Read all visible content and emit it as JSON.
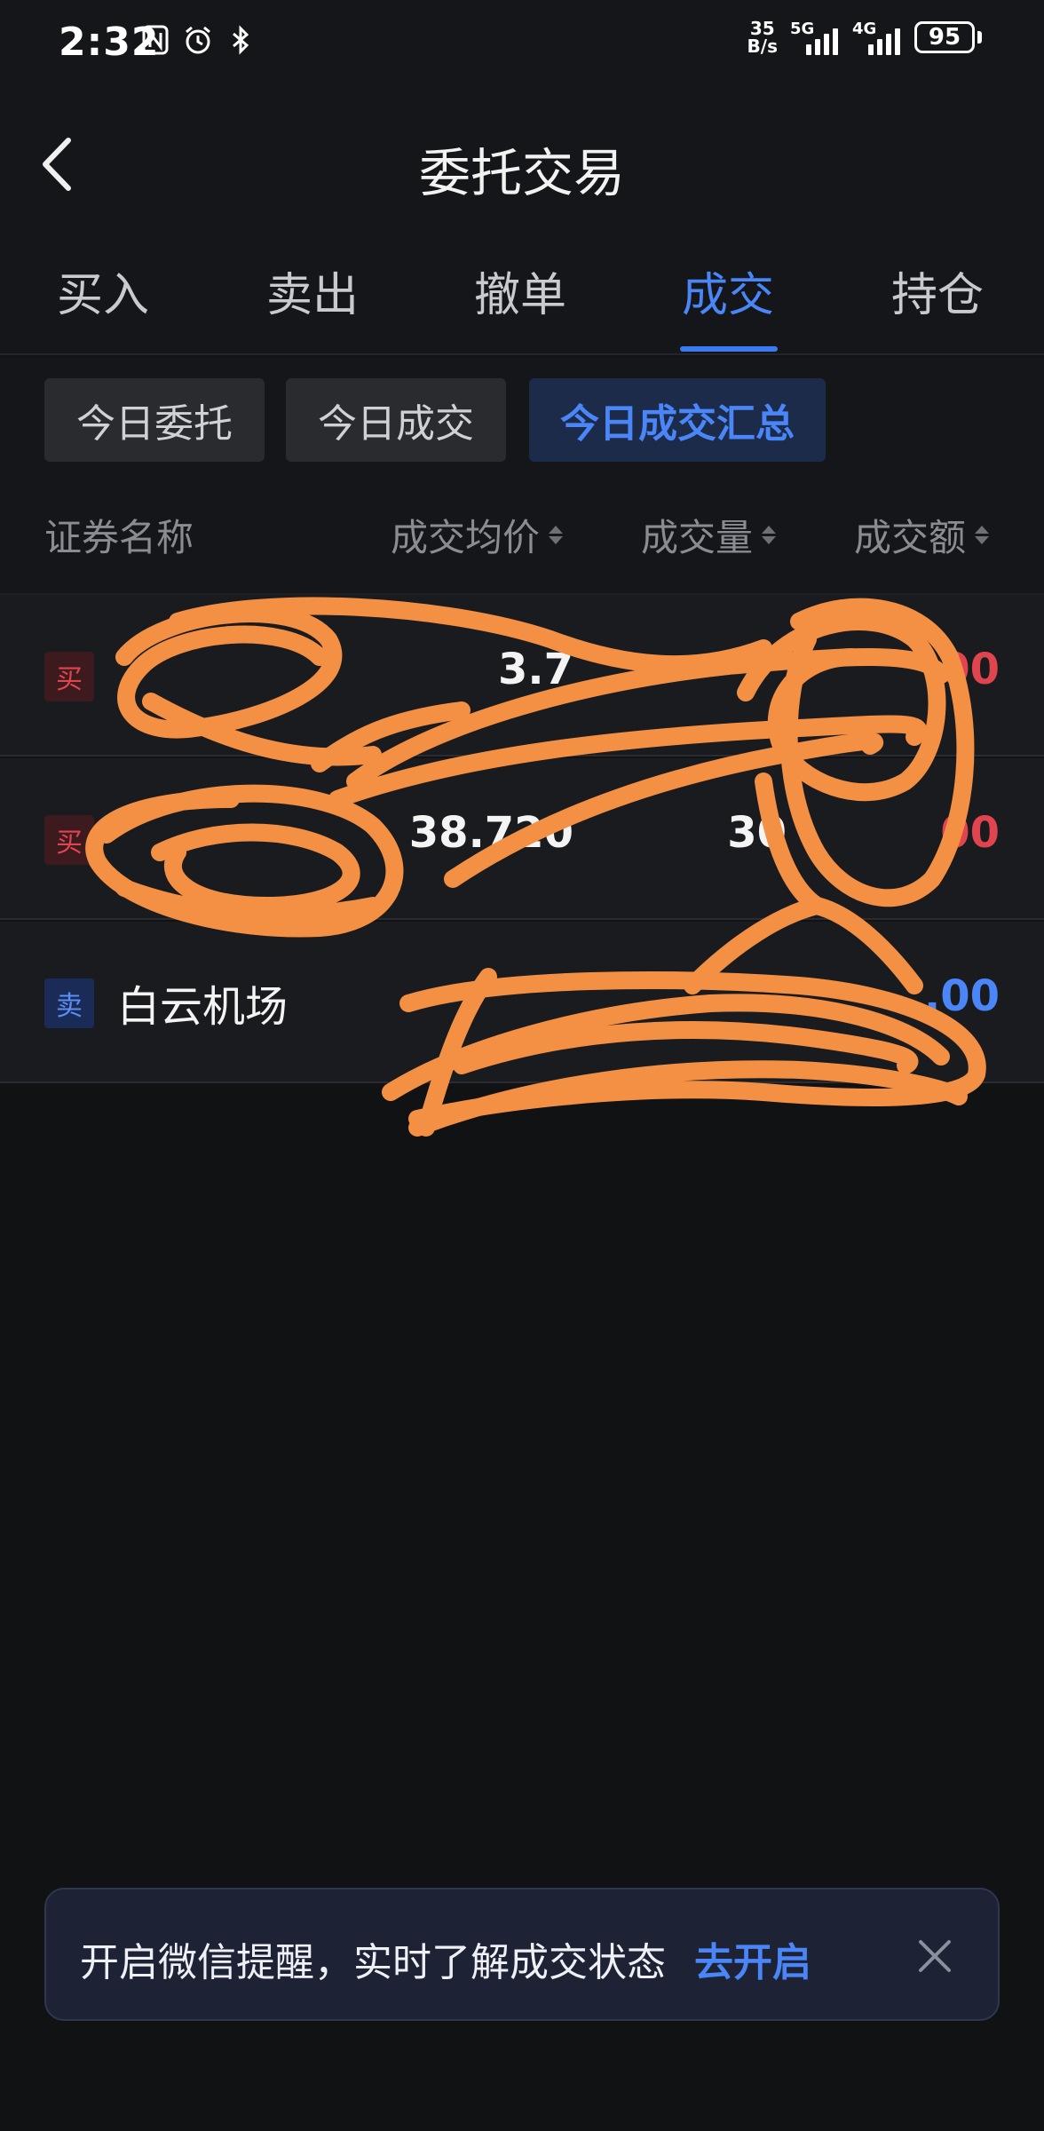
{
  "status_bar": {
    "time": "2:32",
    "net_speed_value": "35",
    "net_speed_unit": "B/s",
    "sim1_network": "5G",
    "sim2_network": "4G",
    "battery": "95"
  },
  "header": {
    "title": "委托交易"
  },
  "tabs": [
    {
      "label": "买入"
    },
    {
      "label": "卖出"
    },
    {
      "label": "撤单"
    },
    {
      "label": "成交",
      "active": true
    },
    {
      "label": "持仓"
    }
  ],
  "subtabs": [
    {
      "label": "今日委托"
    },
    {
      "label": "今日成交"
    },
    {
      "label": "今日成交汇总",
      "active": true
    }
  ],
  "table": {
    "columns": [
      "证券名称",
      "成交均价",
      "成交量",
      "成交额"
    ],
    "rows": [
      {
        "side": "买",
        "name": "",
        "price": "3.7",
        "volume": "",
        "amount": "00"
      },
      {
        "side": "买",
        "name": "",
        "price": "38.720",
        "volume": "30",
        "amount": "00"
      },
      {
        "side": "卖",
        "name": "白云机场",
        "price": "",
        "volume": "",
        "amount": ".00"
      }
    ]
  },
  "banner": {
    "text": "开启微信提醒，实时了解成交状态",
    "link": "去开启"
  },
  "colors": {
    "background": "#111214",
    "accent_blue": "#4a86f7",
    "buy_red": "#e0454f",
    "scribble_orange": "#f39044"
  }
}
